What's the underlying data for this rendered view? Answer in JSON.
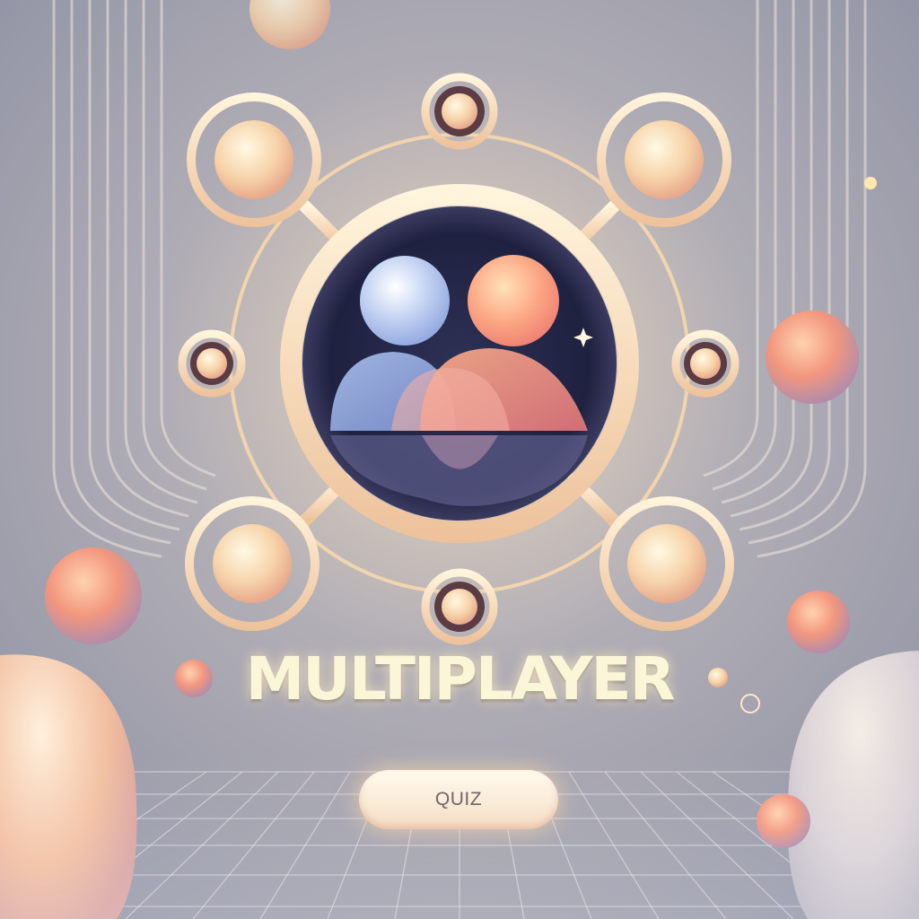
{
  "title": "MULTIPLAYER",
  "quiz_button": {
    "label": "QUIZ"
  },
  "icons": {
    "emblem": "players-network-icon",
    "players": "two-players-icon"
  },
  "colors": {
    "background": "#9ea1b2",
    "ring": "#f5dcb4",
    "player_left": "#8fb2e8",
    "player_right": "#f4907a",
    "title": "#fbf6d8"
  }
}
